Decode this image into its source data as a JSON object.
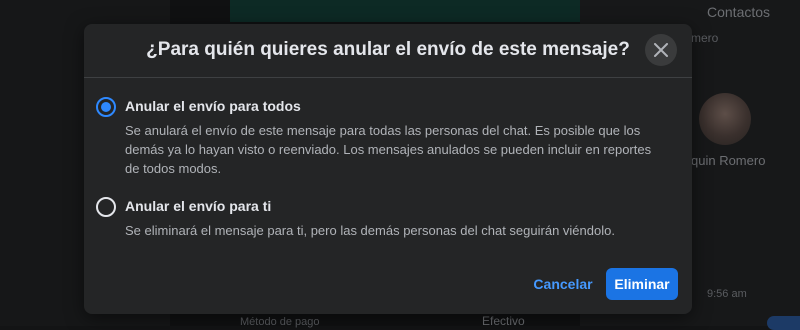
{
  "background": {
    "contacts_heading": "Contactos",
    "contact_partial_1": "mero",
    "contact_partial_2": "quin Romero",
    "time": "9:56 am",
    "footer_left": "Método de pago",
    "footer_right": "Efectivo"
  },
  "dialog": {
    "title": "¿Para quién quieres anular el envío de este mensaje?",
    "close_icon": "close-icon",
    "options": [
      {
        "label": "Anular el envío para todos",
        "description": "Se anulará el envío de este mensaje para todas las personas del chat. Es posible que los demás ya lo hayan visto o reenviado. Los mensajes anulados se pueden incluir en reportes de todos modos.",
        "selected": true
      },
      {
        "label": "Anular el envío para ti",
        "description": "Se eliminará el mensaje para ti, pero las demás personas del chat seguirán viéndolo.",
        "selected": false
      }
    ],
    "cancel_label": "Cancelar",
    "confirm_label": "Eliminar"
  },
  "colors": {
    "accent": "#2e89ff",
    "primary_button": "#1b74e4",
    "dialog_background": "#242526",
    "text_primary": "#e4e6eb",
    "text_secondary": "#b0b3b8"
  }
}
